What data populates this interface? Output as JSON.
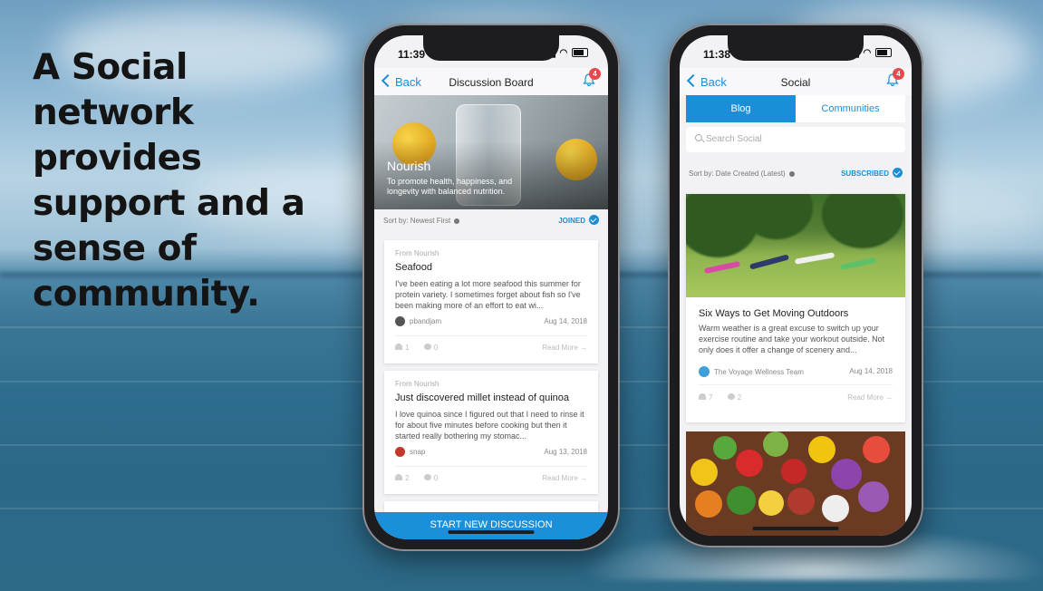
{
  "slide": {
    "headline": "A Social network provides support and a sense of community."
  },
  "colors": {
    "accent": "#1a8fd8",
    "badge": "#e8474b",
    "button": "#1b8fd9"
  },
  "left_phone": {
    "status_time": "11:39",
    "back_label": "Back",
    "title": "Discussion Board",
    "notification_count": "4",
    "hero": {
      "title": "Nourish",
      "subtitle": "To promote health, happiness, and longevity with balanced nutrition."
    },
    "sort_label": "Sort by: Newest First",
    "joined_label": "JOINED",
    "posts": [
      {
        "from": "From Nourish",
        "title": "Seafood",
        "body": "I've been eating a lot more seafood this summer for protein variety. I sometimes forget about fish so I've been making more of an effort to eat wi...",
        "author": "pbandjam",
        "date": "Aug 14, 2018",
        "likes": "1",
        "comments": "0",
        "read_more": "Read More →"
      },
      {
        "from": "From Nourish",
        "title": "Just discovered millet instead of quinoa",
        "body": "I love quinoa since I figured out that I need to rinse it for about five minutes before cooking but then it started really bothering my stomac...",
        "author": "snap",
        "date": "Aug 13, 2018",
        "likes": "2",
        "comments": "0",
        "read_more": "Read More →"
      }
    ],
    "start_button": "START NEW DISCUSSION"
  },
  "right_phone": {
    "status_time": "11:38",
    "back_label": "Back",
    "title": "Social",
    "notification_count": "4",
    "tabs": [
      "Blog",
      "Communities"
    ],
    "search_placeholder": "Search Social",
    "sort_label": "Sort by: Date Created (Latest)",
    "subscribed_label": "SUBSCRIBED",
    "blog": {
      "title": "Six Ways to Get Moving Outdoors",
      "body": "Warm weather is a great excuse to switch up your exercise routine and take your workout outside. Not only does it offer a change of scenery and...",
      "author": "The Voyage Wellness Team",
      "date": "Aug 14, 2018",
      "likes": "7",
      "comments": "2",
      "read_more": "Read More →"
    }
  }
}
